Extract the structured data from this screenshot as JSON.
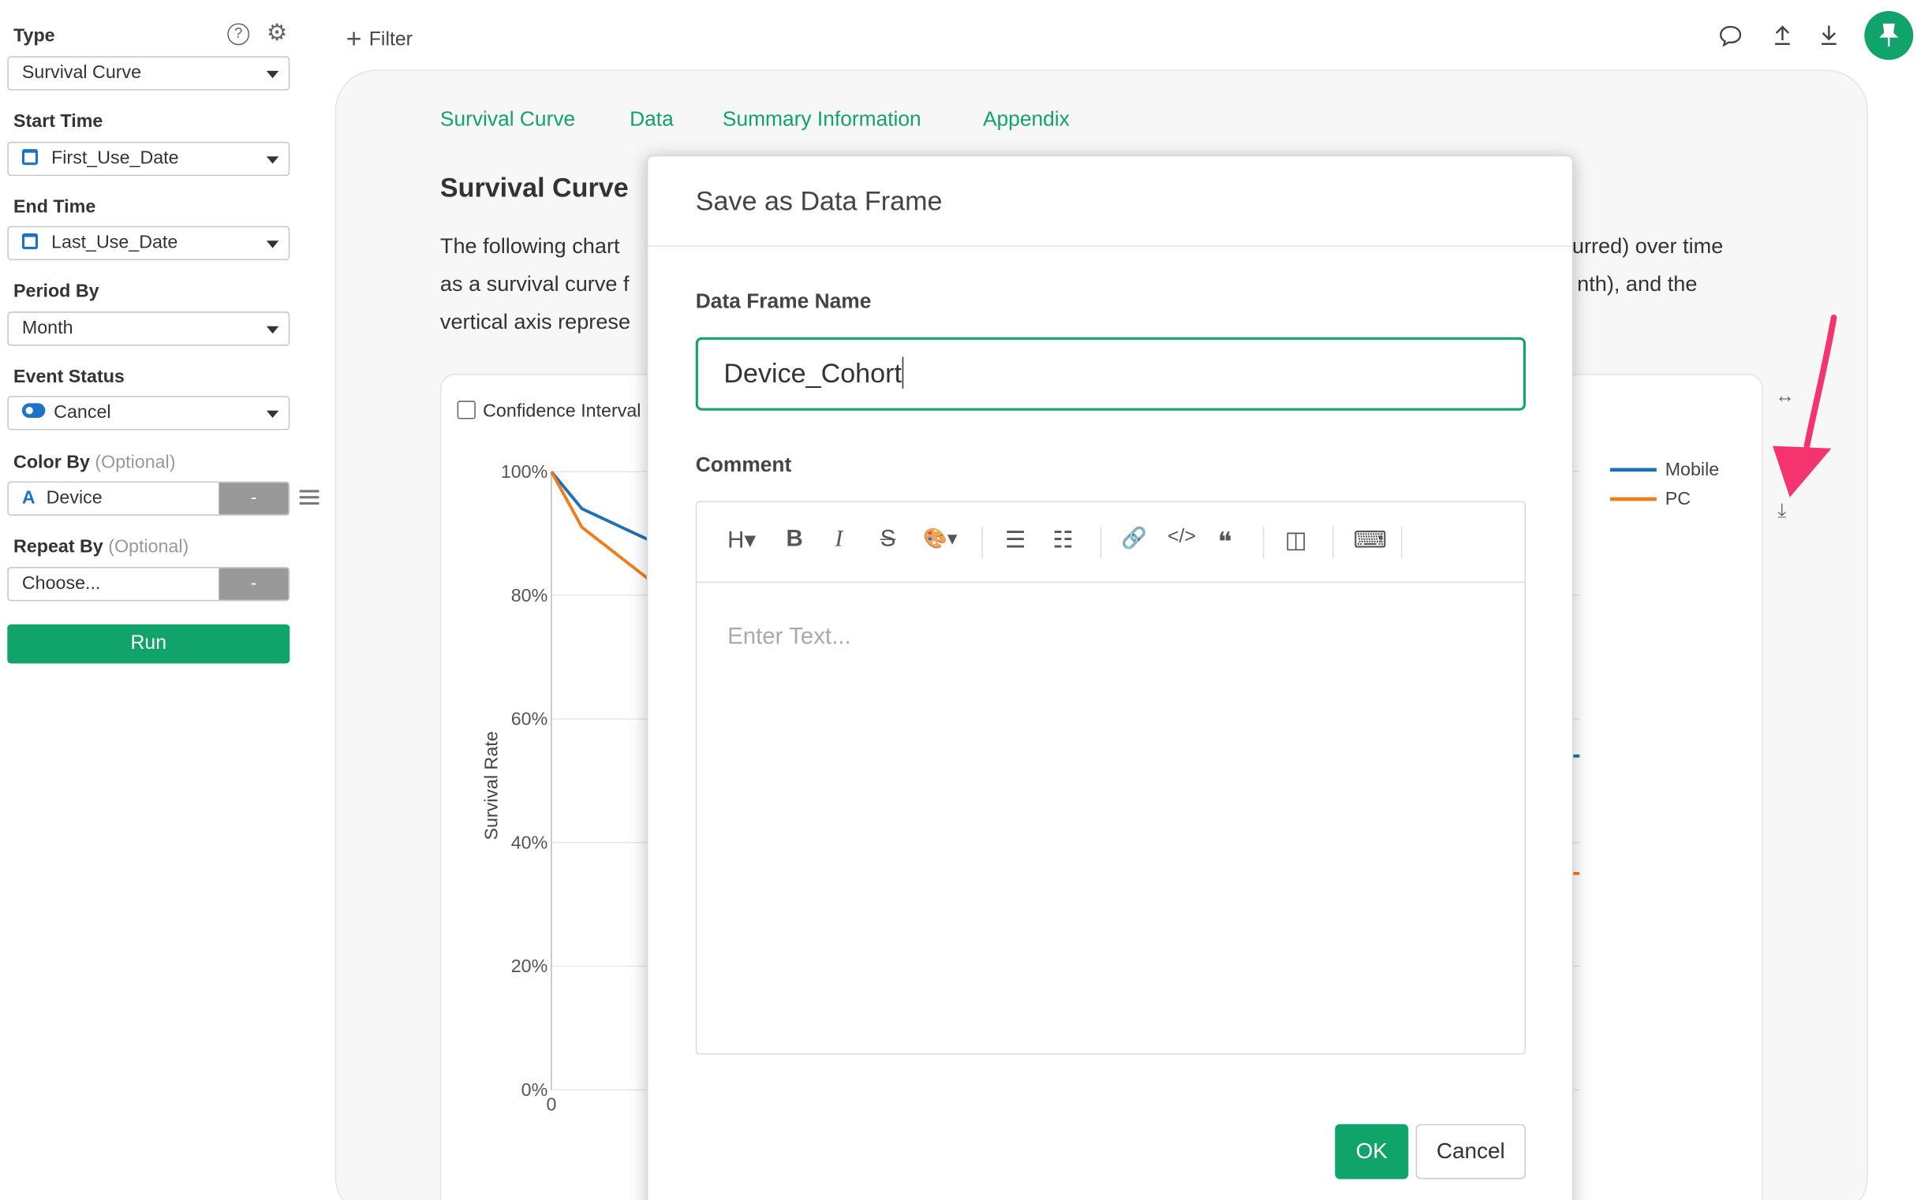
{
  "sidebar": {
    "type": {
      "label": "Type",
      "value": "Survival Curve"
    },
    "start_time": {
      "label": "Start Time",
      "value": "First_Use_Date"
    },
    "end_time": {
      "label": "End Time",
      "value": "Last_Use_Date"
    },
    "period_by": {
      "label": "Period By",
      "value": "Month"
    },
    "event_status": {
      "label": "Event Status",
      "value": "Cancel"
    },
    "color_by": {
      "label": "Color By",
      "optional": "(Optional)",
      "type_glyph": "A",
      "value": "Device",
      "dash": "-"
    },
    "repeat_by": {
      "label": "Repeat By",
      "optional": "(Optional)",
      "value": "Choose...",
      "dash": "-"
    },
    "run_label": "Run",
    "help_glyph": "?",
    "gear_glyph": "⚙"
  },
  "topbar": {
    "filter_label": "Filter",
    "plus_glyph": "+",
    "comment_glyph": "💬",
    "upload_glyph": "⤒",
    "download_glyph": "⤓",
    "pin_glyph": "📌"
  },
  "tabs": [
    "Survival Curve",
    "Data",
    "Summary Information",
    "Appendix"
  ],
  "report": {
    "heading": "Survival Curve",
    "para_line1_left": "The following chart",
    "para_line1_right": "urred) over time",
    "para_line2_left": "as a survival curve f",
    "para_line2_right": "nth), and the",
    "para_line3_left": "vertical axis represe",
    "confidence_label": "Confidence Interval",
    "expand_glyph": "↔",
    "download_glyph": "⤓"
  },
  "chart_data": {
    "type": "line",
    "ylabel": "Survival Rate",
    "yticks": [
      "100%",
      "80%",
      "60%",
      "40%",
      "20%",
      "0%"
    ],
    "xticks": [
      "0"
    ],
    "ylim": [
      0,
      100
    ],
    "series": [
      {
        "name": "Mobile",
        "color": "#1f6fb4",
        "x": [
          0,
          0.25,
          0.9
        ],
        "values": [
          100,
          94,
          88
        ]
      },
      {
        "name": "PC",
        "color": "#f07d18",
        "x": [
          0,
          0.25,
          0.9
        ],
        "values": [
          100,
          91,
          81
        ]
      }
    ],
    "right_edge_values": {
      "Mobile": 54,
      "PC": 35
    }
  },
  "modal": {
    "title": "Save as Data Frame",
    "name_label": "Data Frame Name",
    "name_value": "Device_Cohort",
    "comment_label": "Comment",
    "editor_placeholder": "Enter Text...",
    "toolbar": [
      "H▾",
      "B",
      "I",
      "S",
      "🎨▾",
      "☰",
      "☷",
      "🔗",
      "</>",
      "❝",
      "◫",
      "⌨"
    ],
    "ok_label": "OK",
    "cancel_label": "Cancel"
  },
  "colors": {
    "accent": "#10a46a",
    "annotation_arrow": "#f5336f"
  }
}
